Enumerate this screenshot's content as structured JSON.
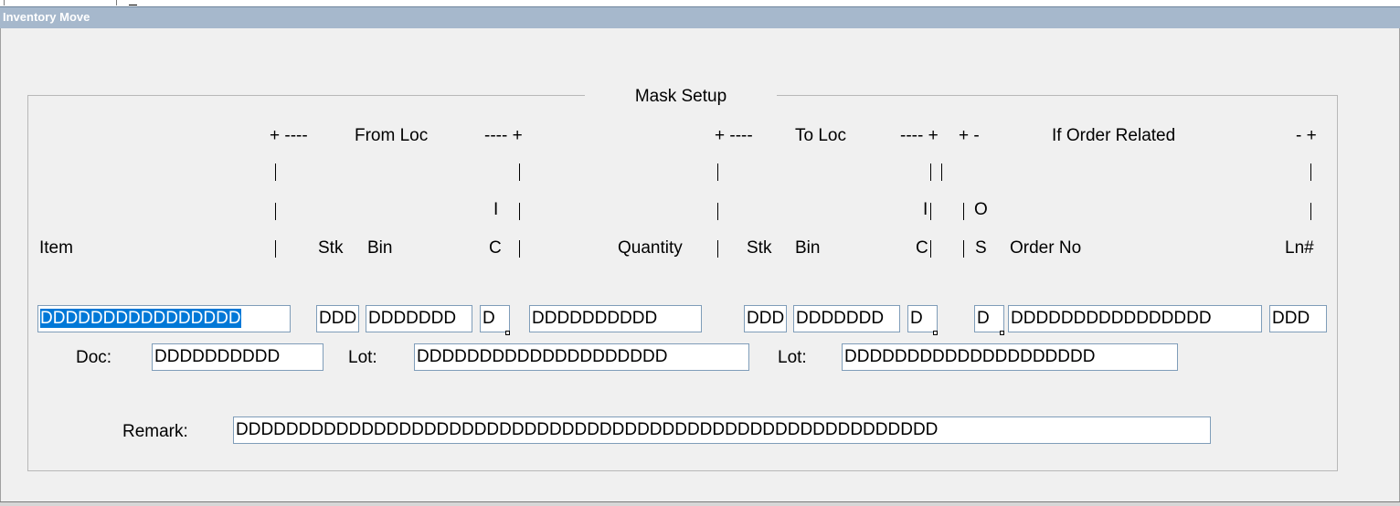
{
  "window": {
    "title": "Inventory Move"
  },
  "group": {
    "title": "Mask Setup"
  },
  "header": {
    "row1": {
      "from_plus_left": "+ ----",
      "from_loc": "From Loc",
      "from_plus_right": "---- +",
      "to_plus_left": "+ ----",
      "to_loc": "To Loc",
      "to_plus_right": "---- +",
      "order_plus_left": "+ -",
      "order_related": "If Order Related",
      "order_plus_right": "- +"
    },
    "row3": {
      "from_i": "I",
      "to_i": "I",
      "order_o": "O"
    },
    "row4": {
      "item": "Item",
      "from_stk": "Stk",
      "from_bin": "Bin",
      "from_c": "C",
      "quantity": "Quantity",
      "to_stk": "Stk",
      "to_bin": "Bin",
      "to_c": "C",
      "order_s": "S",
      "order_no": "Order No",
      "line_no": "Ln#"
    }
  },
  "fields": {
    "item": "DDDDDDDDDDDDDDDD",
    "from_stk": "DDD",
    "from_bin": "DDDDDDD",
    "from_c": "D",
    "quantity": "DDDDDDDDDD",
    "to_stk": "DDD",
    "to_bin": "DDDDDDD",
    "to_c": "D",
    "order_s": "D",
    "order_no": "DDDDDDDDDDDDDDDD",
    "line_no": "DDD",
    "doc_label": "Doc:",
    "doc": "DDDDDDDDDD",
    "from_lot_label": "Lot:",
    "from_lot": "DDDDDDDDDDDDDDDDDDDD",
    "to_lot_label": "Lot:",
    "to_lot": "DDDDDDDDDDDDDDDDDDDD",
    "remark_label": "Remark:",
    "remark": "DDDDDDDDDDDDDDDDDDDDDDDDDDDDDDDDDDDDDDDDDDDDDDDDDDDDDDDD"
  }
}
